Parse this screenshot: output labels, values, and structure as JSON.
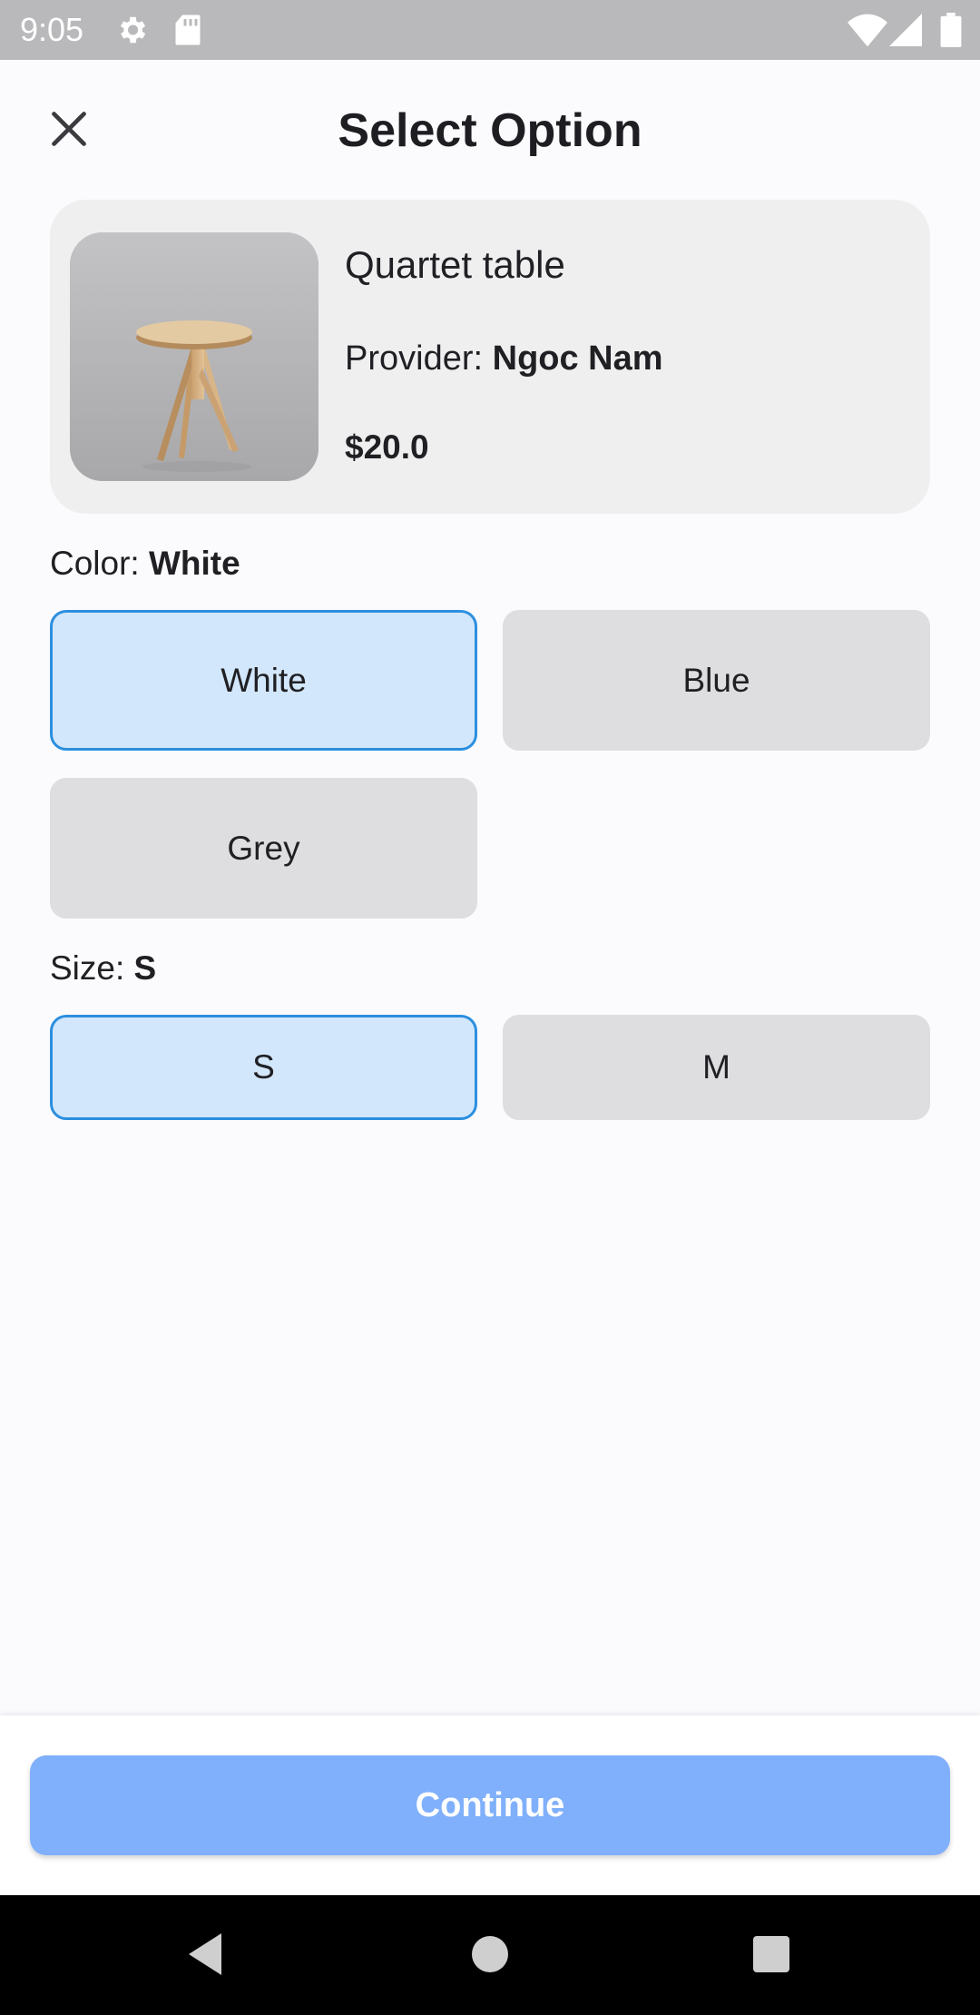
{
  "status_bar": {
    "time": "9:05",
    "icons": [
      "gear-icon",
      "sd-card-icon",
      "wifi-icon",
      "signal-icon",
      "battery-icon"
    ]
  },
  "header": {
    "title": "Select Option",
    "close_icon": "close-icon"
  },
  "product": {
    "name": "Quartet table",
    "provider_label": "Provider:",
    "provider_name": "Ngoc Nam",
    "price": "$20.0"
  },
  "color": {
    "label": "Color:",
    "selected": "White",
    "options": [
      "White",
      "Blue",
      "Grey"
    ]
  },
  "size": {
    "label": "Size:",
    "selected": "S",
    "options": [
      "S",
      "M"
    ]
  },
  "footer": {
    "continue_label": "Continue"
  },
  "theme": {
    "accent": "#2c8fde",
    "selected_bg": "#d3e7fc",
    "option_bg": "#dedee0",
    "continue_bg": "#80b0fb"
  },
  "nav_bar": {
    "icons": [
      "back-icon",
      "home-icon",
      "recents-icon"
    ]
  }
}
